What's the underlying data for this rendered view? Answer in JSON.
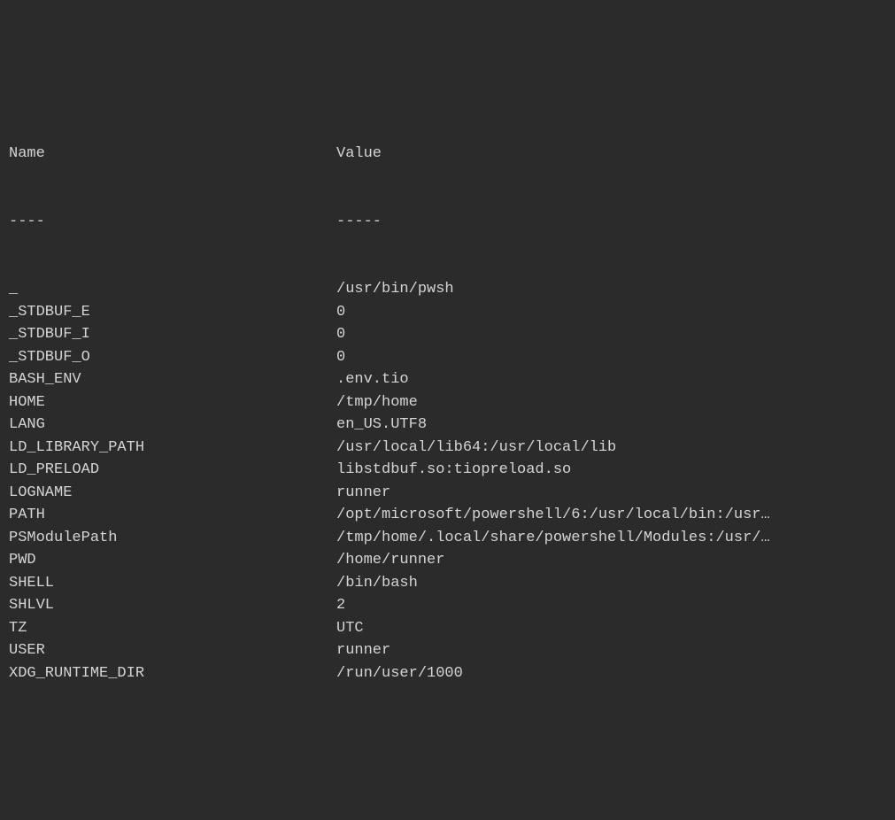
{
  "header": {
    "name_label": "Name",
    "value_label": "Value",
    "name_dashes": "----",
    "value_dashes": "-----"
  },
  "rows": [
    {
      "name": "_",
      "value": "/usr/bin/pwsh"
    },
    {
      "name": "_STDBUF_E",
      "value": "0"
    },
    {
      "name": "_STDBUF_I",
      "value": "0"
    },
    {
      "name": "_STDBUF_O",
      "value": "0"
    },
    {
      "name": "BASH_ENV",
      "value": ".env.tio"
    },
    {
      "name": "HOME",
      "value": "/tmp/home"
    },
    {
      "name": "LANG",
      "value": "en_US.UTF8"
    },
    {
      "name": "LD_LIBRARY_PATH",
      "value": "/usr/local/lib64:/usr/local/lib"
    },
    {
      "name": "LD_PRELOAD",
      "value": "libstdbuf.so:tiopreload.so"
    },
    {
      "name": "LOGNAME",
      "value": "runner"
    },
    {
      "name": "PATH",
      "value": "/opt/microsoft/powershell/6:/usr/local/bin:/usr…"
    },
    {
      "name": "PSModulePath",
      "value": "/tmp/home/.local/share/powershell/Modules:/usr/…"
    },
    {
      "name": "PWD",
      "value": "/home/runner"
    },
    {
      "name": "SHELL",
      "value": "/bin/bash"
    },
    {
      "name": "SHLVL",
      "value": "2"
    },
    {
      "name": "TZ",
      "value": "UTC"
    },
    {
      "name": "USER",
      "value": "runner"
    },
    {
      "name": "XDG_RUNTIME_DIR",
      "value": "/run/user/1000"
    }
  ]
}
